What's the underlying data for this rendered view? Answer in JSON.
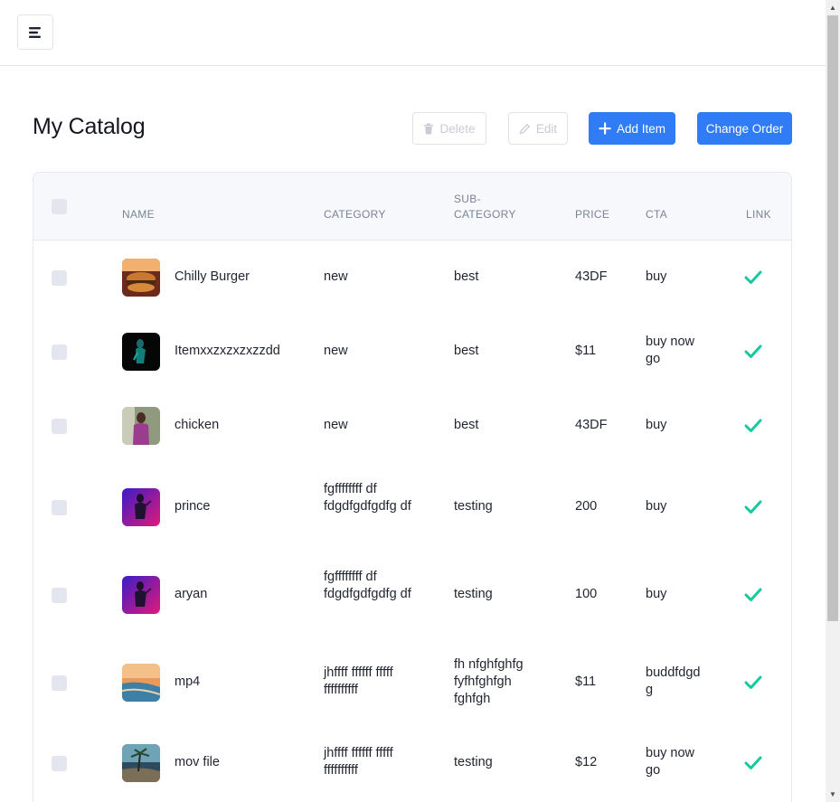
{
  "page": {
    "title": "My Catalog"
  },
  "toolbar": {
    "delete_label": "Delete",
    "edit_label": "Edit",
    "add_label": "Add Item",
    "order_label": "Change Order"
  },
  "table": {
    "headers": {
      "name": "NAME",
      "category": "CATEGORY",
      "subcategory_1": "SUB-",
      "subcategory_2": "CATEGORY",
      "price": "PRICE",
      "cta": "CTA",
      "link": "LINK"
    },
    "rows": [
      {
        "name": "Chilly Burger",
        "category": "new",
        "subcategory": "best",
        "price": "43DF",
        "cta": "buy",
        "link": true
      },
      {
        "name": "Itemxxzxzxzxzzdd",
        "category": "new",
        "subcategory": "best",
        "price": "$11",
        "cta": "buy now go",
        "link": true
      },
      {
        "name": "chicken",
        "category": "new",
        "subcategory": "best",
        "price": "43DF",
        "cta": "buy",
        "link": true
      },
      {
        "name": "prince",
        "category": "fgffffffff df fdgdfgdfgdfg df",
        "subcategory": "testing",
        "price": "200",
        "cta": "buy",
        "link": true
      },
      {
        "name": "aryan",
        "category": "fgffffffff df fdgdfgdfgdfg df",
        "subcategory": "testing",
        "price": "100",
        "cta": "buy",
        "link": true
      },
      {
        "name": "mp4",
        "category": "jhffff ffffff fffff ffffffffff",
        "subcategory": "fh nfghfghfg fyfhfghfgh fghfgh",
        "price": "$11",
        "cta": "buddfdgdg",
        "link": true
      },
      {
        "name": "mov file",
        "category": "jhffff ffffff fffff ffffffffff",
        "subcategory": "testing",
        "price": "$12",
        "cta": "buy now go",
        "link": true
      }
    ]
  },
  "colors": {
    "primary": "#2f7cf6",
    "check": "#14c9a0",
    "header_bg": "#f7f8fb"
  }
}
